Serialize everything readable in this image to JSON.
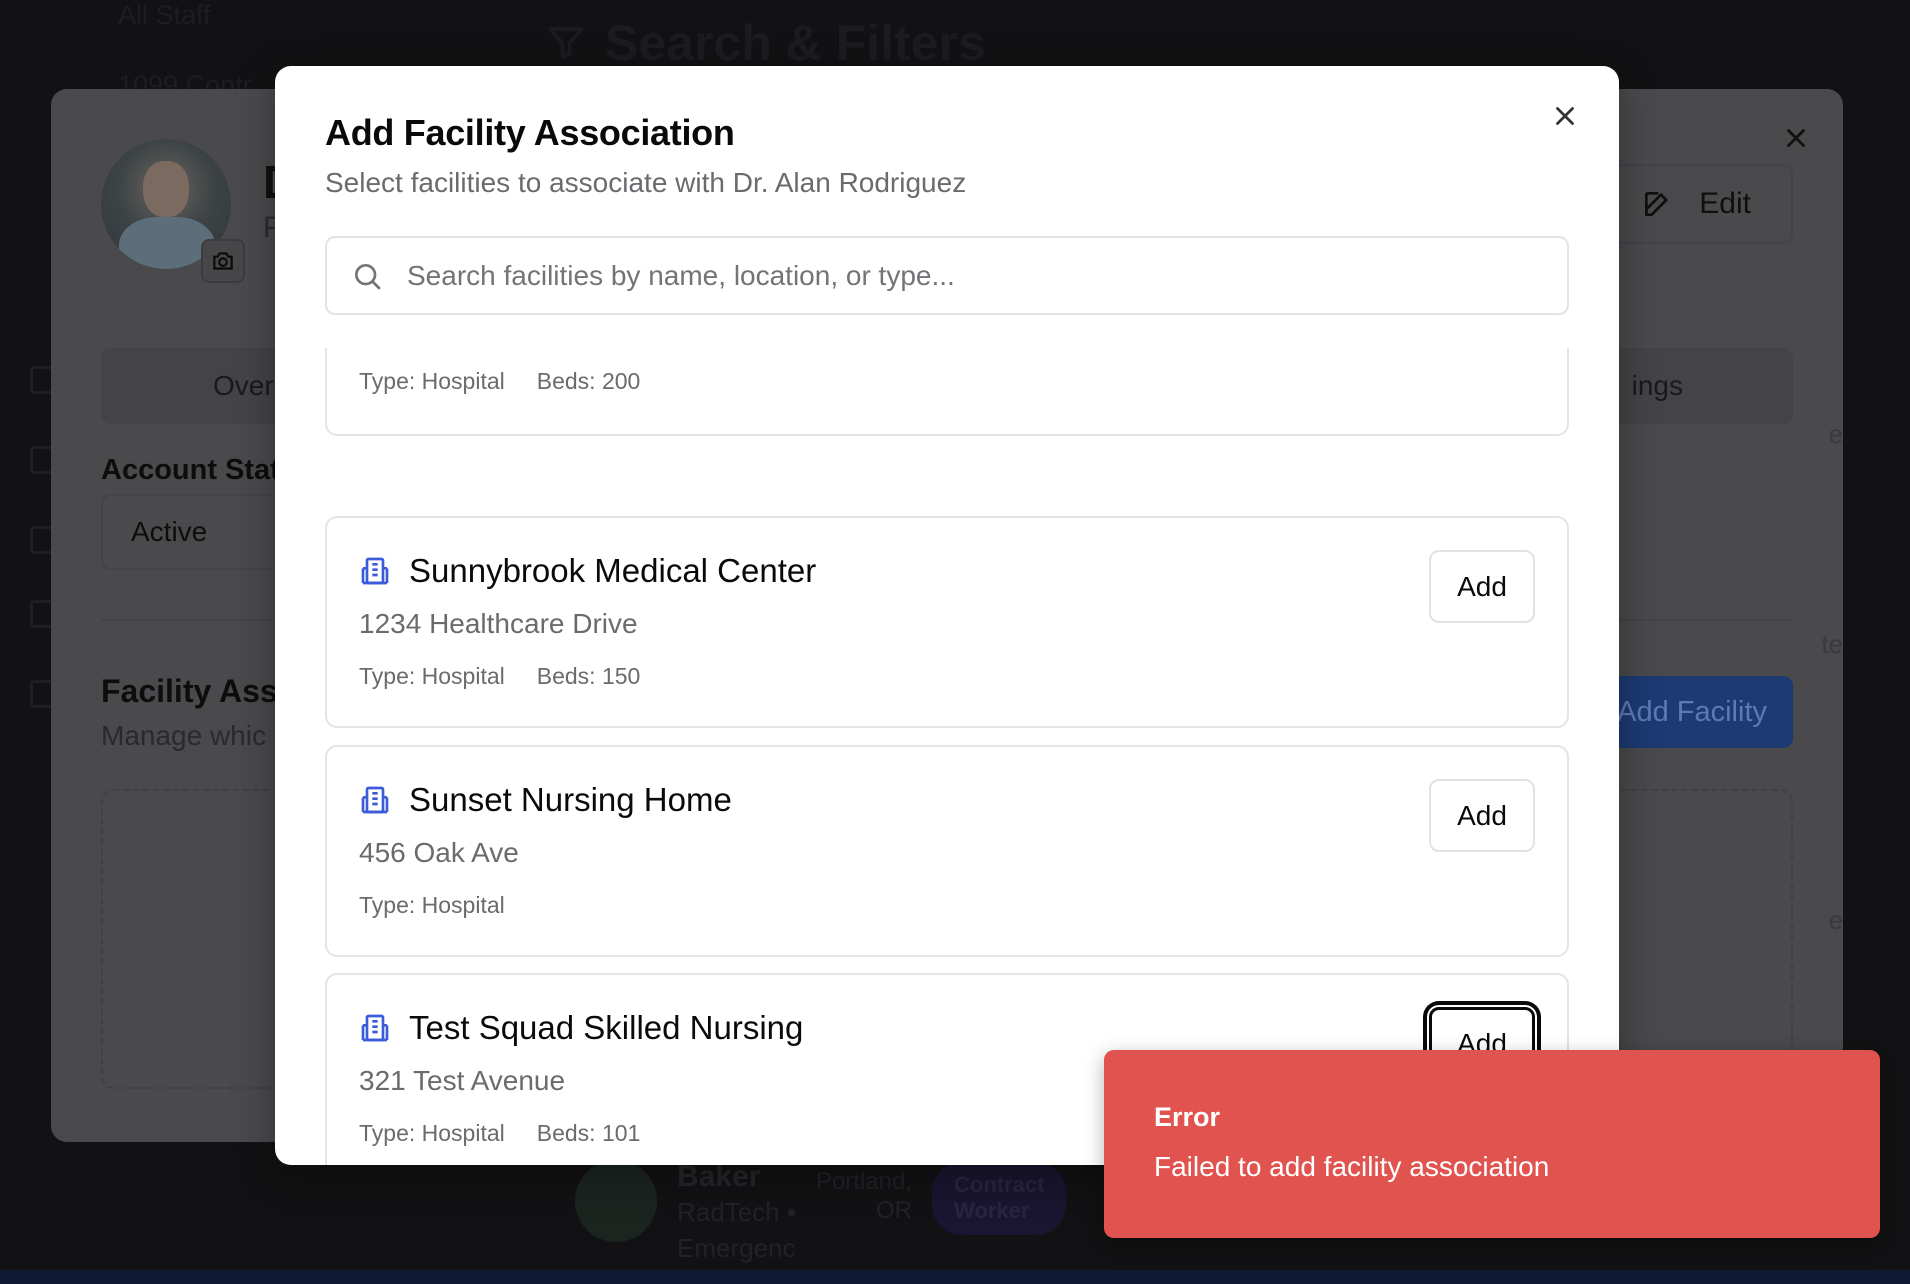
{
  "background": {
    "nav_items": [
      "All Staff",
      "1099 Contr"
    ],
    "page_heading": "Search & Filters",
    "result_row": {
      "name": "Baker",
      "subtitle_lines": [
        "RadTech •",
        "Emergenc"
      ],
      "location_lines": [
        "Portland,",
        "OR"
      ],
      "badge_lines": [
        "Contract",
        "Worker"
      ]
    }
  },
  "profile_dialog": {
    "name_initial": "D",
    "subtitle_initial": "P",
    "edit_label": "Edit",
    "tabs": [
      "Over",
      "ings"
    ],
    "account_status_label": "Account Stat",
    "account_status_value": "Active",
    "facility_section_title": "Facility Ass",
    "facility_section_subtitle": "Manage whic",
    "add_facility_label": "Add Facility",
    "edge_fragments": [
      "e",
      "te",
      "e"
    ]
  },
  "modal": {
    "title": "Add Facility Association",
    "description": "Select facilities to associate with Dr. Alan Rodriguez",
    "search_placeholder": "Search facilities by name, location, or type...",
    "search_value": "",
    "facilities": [
      {
        "name": "",
        "address": "",
        "type": "Type: Hospital",
        "beds": "Beds: 200",
        "add_label": ""
      },
      {
        "name": "Sunnybrook Medical Center",
        "address": "1234 Healthcare Drive",
        "type": "Type: Hospital",
        "beds": "Beds: 150",
        "add_label": "Add"
      },
      {
        "name": "Sunset Nursing Home",
        "address": "456 Oak Ave",
        "type": "Type: Hospital",
        "beds": "",
        "add_label": "Add"
      },
      {
        "name": "Test Squad Skilled Nursing",
        "address": "321 Test Avenue",
        "type": "Type: Hospital",
        "beds": "Beds: 101",
        "add_label": "Add"
      }
    ]
  },
  "toast": {
    "title": "Error",
    "message": "Failed to add facility association",
    "color": "#e0534f"
  },
  "colors": {
    "accent_blue": "#1d4ed8",
    "facility_icon": "#3b5bdb"
  },
  "icons": {
    "filter": "filter-icon",
    "close": "close-icon",
    "search": "search-icon",
    "building": "building-icon",
    "camera": "camera-icon",
    "edit": "edit-icon"
  }
}
